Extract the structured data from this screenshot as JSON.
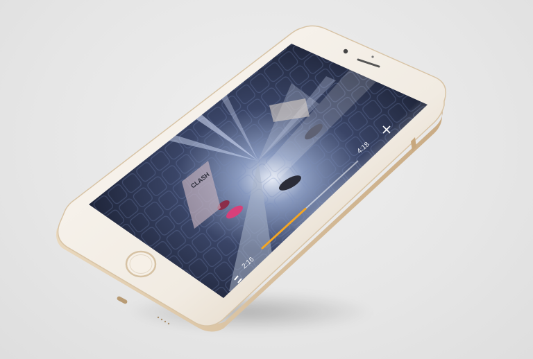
{
  "player": {
    "elapsed_time": "2:16",
    "total_time": "4:18",
    "progress": 0.45,
    "controls": {
      "play_pause_icon": "pause-icon",
      "close_icon": "close-icon"
    }
  },
  "device": {
    "frame_color": "#f2ece4",
    "screen_color": "#1b2030",
    "accent_color": "#f5a623"
  }
}
